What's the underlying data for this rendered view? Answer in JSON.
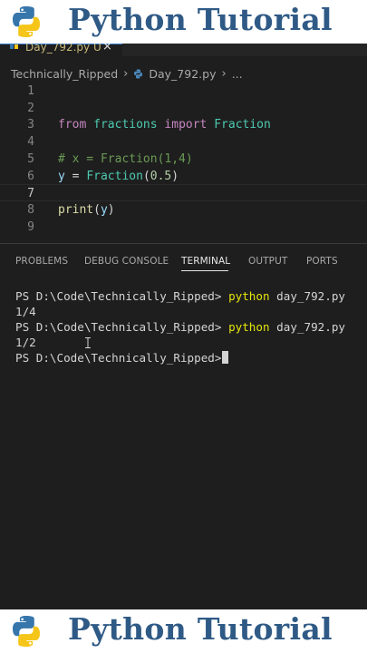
{
  "banner": {
    "title": "Python Tutorial"
  },
  "tab": {
    "label": "Day_792.py U",
    "close": "×"
  },
  "breadcrumb": {
    "folder": "Technically_Ripped",
    "file": "Day_792.py",
    "more": "..."
  },
  "editor": {
    "lines": [
      {
        "n": "1"
      },
      {
        "n": "2"
      },
      {
        "n": "3",
        "tokens": [
          "from",
          "fractions",
          "import",
          "Fraction"
        ]
      },
      {
        "n": "4"
      },
      {
        "n": "5",
        "comment": "# x = Fraction(1,4)"
      },
      {
        "n": "6",
        "tokens": [
          "y",
          "=",
          "Fraction",
          "(",
          "0.5",
          ")"
        ]
      },
      {
        "n": "7"
      },
      {
        "n": "8",
        "tokens": [
          "print",
          "(",
          "y",
          ")"
        ]
      },
      {
        "n": "9"
      }
    ]
  },
  "panel": {
    "tabs": [
      "PROBLEMS",
      "DEBUG CONSOLE",
      "TERMINAL",
      "OUTPUT",
      "PORTS"
    ],
    "active": "TERMINAL"
  },
  "terminal": {
    "prompt": "PS D:\\Code\\Technically_Ripped>",
    "cmd": "python",
    "arg": "day_792.py",
    "out1": "1/4",
    "out2": "1/2"
  },
  "colors": {
    "accent": "#2f5a86",
    "terminal_cmd": "#e5e510"
  }
}
